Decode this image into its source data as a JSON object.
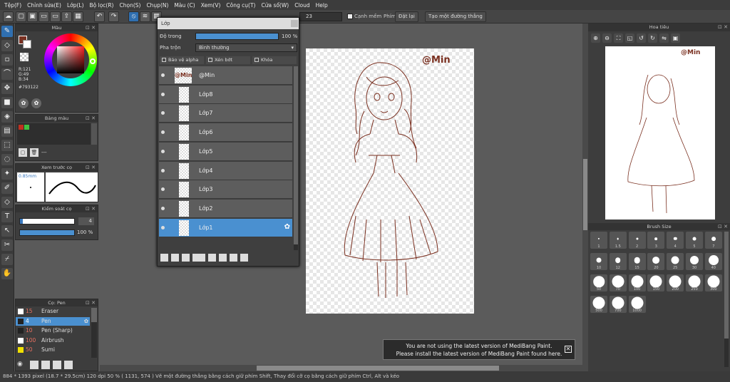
{
  "menu": [
    "Tệp(F)",
    "Chỉnh sửa(E)",
    "Lớp(L)",
    "Bộ lọc(R)",
    "Chọn(S)",
    "Chụp(N)",
    "Màu (C)",
    "Xem(V)",
    "Công cụ(T)",
    "Cửa sổ(W)",
    "Cloud",
    "Help"
  ],
  "toolbar": {
    "antialias_label": "Cạnh mềm",
    "brush_size_value": "23",
    "snap_label": "Phím",
    "snap_off": "Đặt lại",
    "straight_line": "Tạo một đường thẳng"
  },
  "color_panel": {
    "title": "Màu",
    "r": "R:121",
    "g": "G:49",
    "b": "B:34",
    "hex": "#793122",
    "current_color": "#793122"
  },
  "palette": {
    "title": "Bảng màu",
    "swatches": [
      "#c03020",
      "#40c040"
    ],
    "current": "---"
  },
  "preview": {
    "title": "Xem trước cọ",
    "size": "0.85mm"
  },
  "brush_control": {
    "title": "Kiểm soát cọ",
    "size": "4",
    "opacity": "100 %"
  },
  "brush_list": {
    "title": "Cọ: Pen",
    "items": [
      {
        "size": "15",
        "name": "Eraser",
        "color": "#ffffff"
      },
      {
        "size": "4",
        "name": "Pen",
        "color": "#222222",
        "selected": true
      },
      {
        "size": "10",
        "name": "Pen (Sharp)",
        "color": "#222222"
      },
      {
        "size": "100",
        "name": "Airbrush",
        "color": "#ffffff"
      },
      {
        "size": "50",
        "name": "Sumi",
        "color": "#f0e000"
      }
    ]
  },
  "layer_window": {
    "title": "Lớp",
    "opacity_label": "Độ trong",
    "opacity_value": "100 %",
    "blend_label": "Pha trộn",
    "blend_value": "Bình thường",
    "protect_alpha": "Bảo vệ alpha",
    "clipping": "Xén bớt",
    "lock": "Khóa",
    "layers": [
      {
        "name": "@Min",
        "thumb": "@Min"
      },
      {
        "name": "Lớp8"
      },
      {
        "name": "Lớp7"
      },
      {
        "name": "Lớp6"
      },
      {
        "name": "Lớp5"
      },
      {
        "name": "Lớp4"
      },
      {
        "name": "Lớp3"
      },
      {
        "name": "Lớp2"
      },
      {
        "name": "Lớp1",
        "selected": true
      }
    ]
  },
  "canvas": {
    "watermark": "@Min",
    "line_color": "#7a3020"
  },
  "navigator": {
    "title": "Hoa tiêu",
    "watermark": "@Min"
  },
  "brush_size": {
    "title": "Brush Size",
    "sizes": [
      "1",
      "1.5",
      "2",
      "3",
      "4",
      "5",
      "7",
      "10",
      "12",
      "15",
      "20",
      "25",
      "30",
      "40",
      "50",
      "70",
      "100",
      "150",
      "200",
      "250",
      "300",
      "500",
      "700",
      "1000"
    ]
  },
  "notification": {
    "line1": "You are not using the latest version of MediBang Paint.",
    "line2": "Please install the latest version of MediBang Paint found here."
  },
  "status": "884 * 1393 pixel  (18.7 * 29.5cm)  120 dpi  50 %  ( 1131, 574 )  Vẽ một đường thẳng bằng cách giữ phím Shift, Thay đổi cỡ cọ bằng cách giữ phím Ctrl, Alt và kéo"
}
